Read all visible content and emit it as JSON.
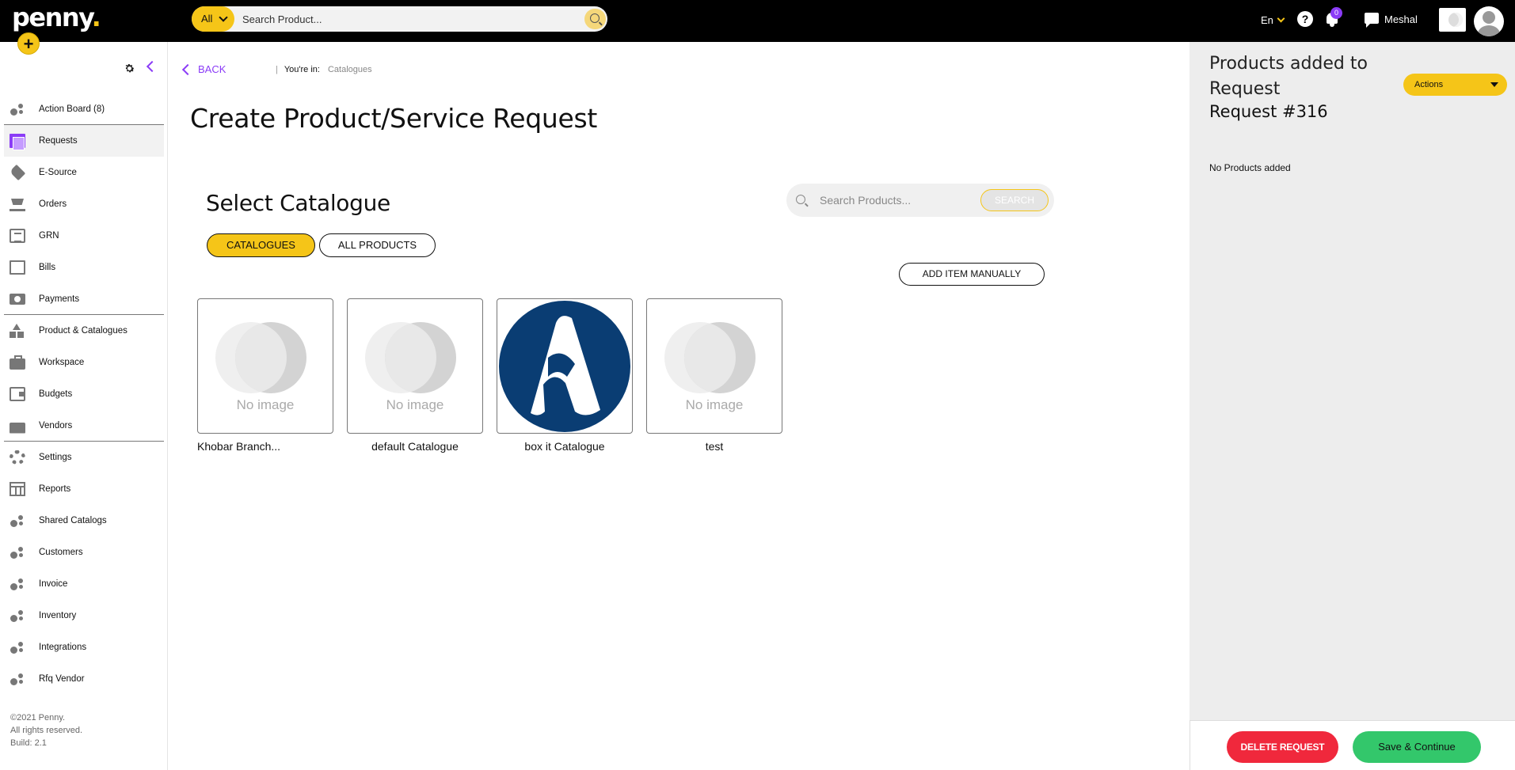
{
  "app": {
    "logo": "penny",
    "add_icon": "plus-icon",
    "accent_color": "#f5c518",
    "brand_purple": "#8b3cf7"
  },
  "topbar": {
    "search_category": "All",
    "search_placeholder": "Search Product...",
    "language": "En",
    "help_label": "?",
    "notification_count": "0",
    "user_name": "Meshal"
  },
  "sidebar": {
    "items": [
      {
        "label": "Action Board (8)",
        "icon": "dots-icon"
      },
      {
        "label": "Requests",
        "icon": "document-icon"
      },
      {
        "label": "E-Source",
        "icon": "tag-icon"
      },
      {
        "label": "Orders",
        "icon": "cart-icon"
      },
      {
        "label": "GRN",
        "icon": "list-icon"
      },
      {
        "label": "Bills",
        "icon": "bill-icon"
      },
      {
        "label": "Payments",
        "icon": "payment-icon"
      },
      {
        "label": "Product & Catalogues",
        "icon": "shapes-icon"
      },
      {
        "label": "Workspace",
        "icon": "briefcase-icon"
      },
      {
        "label": "Budgets",
        "icon": "wallet-icon"
      },
      {
        "label": "Vendors",
        "icon": "store-icon"
      },
      {
        "label": "Settings",
        "icon": "gear-icon"
      },
      {
        "label": "Reports",
        "icon": "table-icon"
      },
      {
        "label": "Shared Catalogs",
        "icon": "dots-icon"
      },
      {
        "label": "Customers",
        "icon": "dots-icon"
      },
      {
        "label": "Invoice",
        "icon": "dots-icon"
      },
      {
        "label": "Inventory",
        "icon": "dots-icon"
      },
      {
        "label": "Integrations",
        "icon": "dots-icon"
      },
      {
        "label": "Rfq Vendor",
        "icon": "dots-icon"
      }
    ],
    "copyright": [
      "©2021 Penny.",
      "All rights reserved.",
      "Build: 2.1"
    ]
  },
  "main": {
    "back_label": "BACK",
    "breadcrumb_prefix": "You're in:",
    "breadcrumb_current": "Catalogues",
    "page_title": "Create Product/Service Request",
    "section_title": "Select Catalogue",
    "product_search_placeholder": "Search Products...",
    "product_search_button": "SEARCH",
    "tabs": [
      {
        "label": "CATALOGUES",
        "active": true
      },
      {
        "label": "ALL PRODUCTS",
        "active": false
      }
    ],
    "add_manual_label": "ADD ITEM MANUALLY",
    "no_image_text": "No image",
    "catalogues": [
      {
        "name": "Khobar Branch...",
        "has_image": false
      },
      {
        "name": "default Catalogue",
        "has_image": false
      },
      {
        "name": "box it Catalogue",
        "has_image": true
      },
      {
        "name": "test",
        "has_image": false
      }
    ]
  },
  "right_panel": {
    "title": "Products added to Request",
    "request_number": "Request #316",
    "actions_label": "Actions",
    "empty_text": "No Products added",
    "delete_label": "DELETE REQUEST",
    "save_label": "Save & Continue"
  }
}
